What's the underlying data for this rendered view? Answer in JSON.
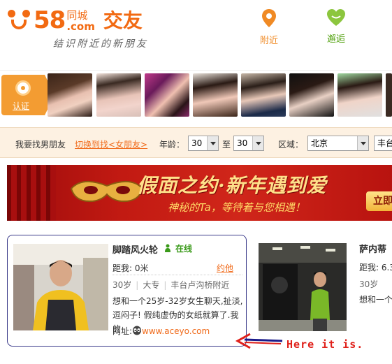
{
  "header": {
    "logo_number": "58",
    "logo_city": "同城",
    "logo_domain": ".com",
    "logo_title": "交友",
    "slogan": "结识附近的新朋友",
    "nav": [
      {
        "label": "附近",
        "icon": "location-pin-icon",
        "color": "#f08a24"
      },
      {
        "label": "邂逅",
        "icon": "heart-icon",
        "color": "#8cc63e"
      }
    ]
  },
  "strip": {
    "auth_label": "认证",
    "auth_color": "#f39c32",
    "thumbnails": 8
  },
  "filter": {
    "seeking_text": "我要找男朋友",
    "switch_link": "切换到找<女朋友>",
    "age_label": "年龄：",
    "age_from": "30",
    "age_to_label": "至",
    "age_to": "30",
    "region_label": "区域：",
    "region_value": "北京",
    "district_value": "丰台"
  },
  "banner": {
    "title": "假面之约·新年遇到爱",
    "subtitle": "神秘的Ta，等待着与您相遇！",
    "button": "立即"
  },
  "cards": [
    {
      "name": "脚踏风火轮",
      "online": "在线",
      "distance": "距我: 0米",
      "greet": "约他",
      "age": "30岁",
      "edu": "大专",
      "location": "丰台卢沟桥附近",
      "desc": "想和一个25岁-32岁女生聊天,扯淡,逗闷子! 假纯虚伪的女纸就算了.我的",
      "url_label": "网址:",
      "url": "www.aceyo.com"
    },
    {
      "name": "萨内蒂",
      "distance": "距我: 6.3",
      "age": "30岁",
      "desc": "想和一个"
    }
  ],
  "annotation": "Here it is."
}
